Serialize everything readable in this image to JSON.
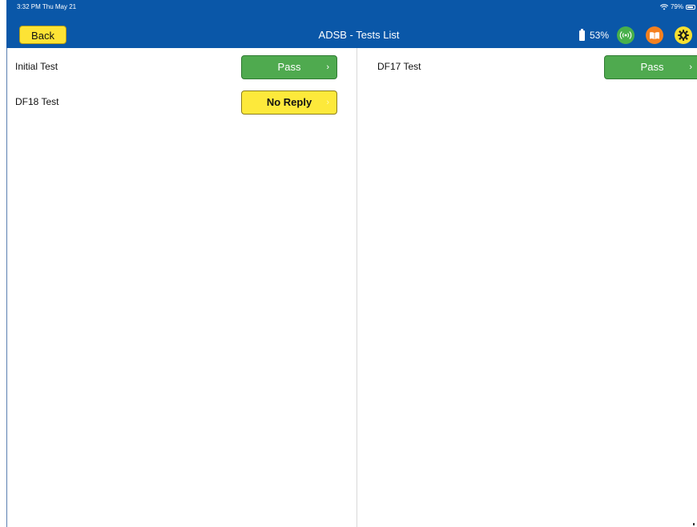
{
  "status_bar": {
    "time": "3:32 PM  Thu May 21",
    "battery_percent": "79%"
  },
  "nav": {
    "back_label": "Back",
    "title": "ADSB - Tests List",
    "device_battery": "53%",
    "icons": [
      "signal-icon",
      "book-icon",
      "gear-icon"
    ]
  },
  "tests": {
    "left": [
      {
        "name": "Initial Test",
        "result": "Pass",
        "status": "pass"
      },
      {
        "name": "DF18 Test",
        "result": "No Reply",
        "status": "noreply"
      }
    ],
    "right": [
      {
        "name": "DF17 Test",
        "result": "Pass",
        "status": "pass"
      }
    ]
  },
  "colors": {
    "header": "#0a57a8",
    "pass": "#4faa4f",
    "noreply": "#fde93b",
    "back_button": "#fde335"
  }
}
